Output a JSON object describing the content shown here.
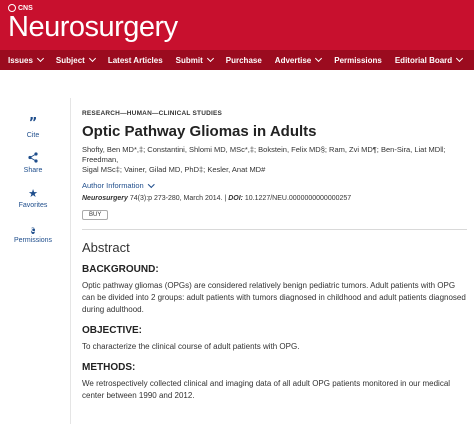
{
  "header": {
    "org": "CNS",
    "journal_name": "Neurosurgery"
  },
  "nav": {
    "items": [
      {
        "label": "Issues",
        "dropdown": true
      },
      {
        "label": "Subject",
        "dropdown": true
      },
      {
        "label": "Latest Articles",
        "dropdown": false
      },
      {
        "label": "Submit",
        "dropdown": true
      },
      {
        "label": "Purchase",
        "dropdown": false
      },
      {
        "label": "Advertise",
        "dropdown": true
      },
      {
        "label": "Permissions",
        "dropdown": false
      },
      {
        "label": "Editorial Board",
        "dropdown": true
      }
    ]
  },
  "sidebar": {
    "items": [
      {
        "label": "Cite",
        "icon": "quote-icon"
      },
      {
        "label": "Share",
        "icon": "share-icon"
      },
      {
        "label": "Favorites",
        "icon": "star-icon"
      },
      {
        "label": "Permissions",
        "icon": "copyright-icon"
      }
    ]
  },
  "article": {
    "kicker": "RESEARCH—HUMAN—CLINICAL STUDIES",
    "title": "Optic Pathway Gliomas in Adults",
    "authors_line1": "Shofty, Ben MD*,‡; Constantini, Shlomi MD, MSc*,‡; Bokstein, Felix MD§; Ram, Zvi MD¶; Ben-Sira, Liat MD‖; Freedman,",
    "authors_line2": "Sigal MSc‡; Vainer, Gilad MD, PhD‡; Kesler, Anat MD#",
    "author_info_label": "Author Information",
    "journal": "Neurosurgery",
    "citation_volume": " 74(3):p 273-280, March 2014. | ",
    "doi_label": "DOI:",
    "doi_value": " 10.1227/NEU.0000000000000257",
    "buy_label": "BUY"
  },
  "abstract": {
    "heading": "Abstract",
    "sections": [
      {
        "heading": "BACKGROUND:",
        "text": "Optic pathway gliomas (OPGs) are considered relatively benign pediatric tumors. Adult patients with OPG can be divided into 2 groups: adult patients with tumors diagnosed in childhood and adult patients diagnosed during adulthood."
      },
      {
        "heading": "OBJECTIVE:",
        "text": "To characterize the clinical course of adult patients with OPG."
      },
      {
        "heading": "METHODS:",
        "text": "We retrospectively collected clinical and imaging data of all adult OPG patients monitored in our medical center between 1990 and 2012."
      }
    ]
  },
  "colors": {
    "brand_red": "#c8102e",
    "nav_red": "#9b0b1f",
    "link_blue": "#1f4e8c"
  }
}
